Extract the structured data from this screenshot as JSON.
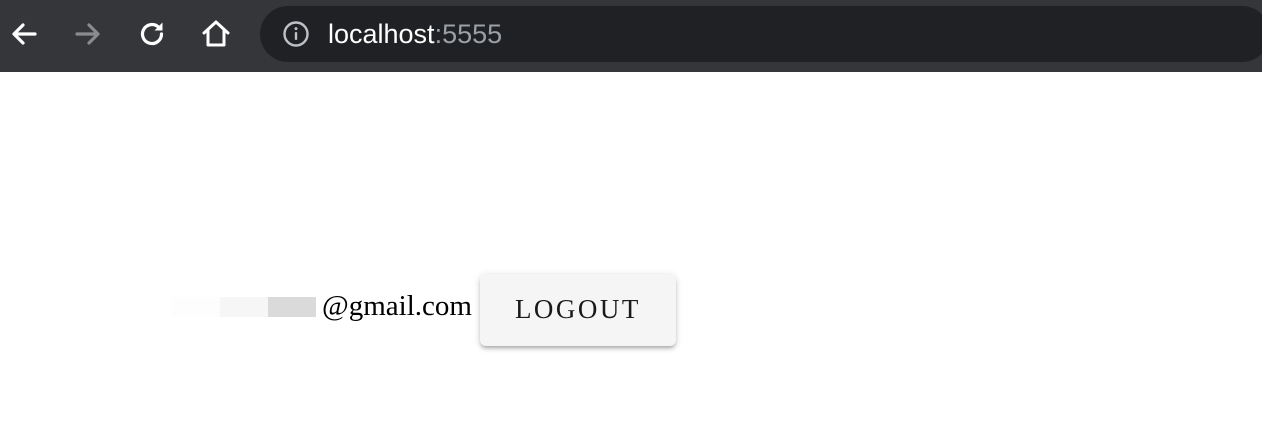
{
  "browser": {
    "nav": {
      "back_icon": "arrow-left-icon",
      "forward_icon": "arrow-right-icon",
      "forward_disabled": true,
      "reload_icon": "reload-icon",
      "home_icon": "home-icon"
    },
    "omnibox": {
      "info_icon": "info-circle-icon",
      "url_host": "localhost",
      "url_port": ":5555"
    },
    "colors": {
      "toolbar": "#35363a",
      "omnibox": "#202124",
      "icon_active": "#ffffff",
      "icon_disabled": "#8a8b8e",
      "url_port": "#9aa0a6"
    }
  },
  "page": {
    "email_redacted": true,
    "email_domain": "@gmail.com",
    "logout_label": "LOGOUT",
    "colors": {
      "background": "#ffffff",
      "button_bg": "#f5f5f5",
      "text": "#000000"
    }
  }
}
